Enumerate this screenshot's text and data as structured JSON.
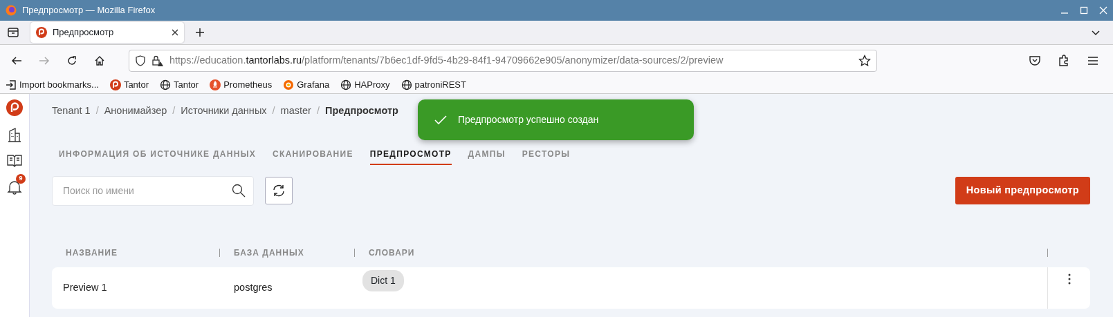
{
  "window": {
    "title": "Предпросмотр — Mozilla Firefox"
  },
  "browser_tabs": [
    {
      "label": "Предпросмотр",
      "selected": true
    }
  ],
  "address_bar": {
    "url_parts": [
      {
        "text": "https://education.",
        "emphasis": false
      },
      {
        "text": "tantorlabs.ru",
        "emphasis": true
      },
      {
        "text": "/platform/tenants/7b6ec1df-9fd5-4b29-84f1-94709662e905/anonymizer/data-sources/2/preview",
        "emphasis": false
      }
    ]
  },
  "bookmarks": [
    {
      "label": "Import bookmarks...",
      "kind": "import"
    },
    {
      "label": "Tantor",
      "kind": "tantor"
    },
    {
      "label": "Tantor",
      "kind": "globe"
    },
    {
      "label": "Prometheus",
      "kind": "prometheus"
    },
    {
      "label": "Grafana",
      "kind": "grafana"
    },
    {
      "label": "HAProxy",
      "kind": "globe"
    },
    {
      "label": "patroniREST",
      "kind": "globe"
    }
  ],
  "sidebar": {
    "notification_count": "9"
  },
  "breadcrumbs": [
    {
      "label": "Tenant 1",
      "current": false
    },
    {
      "separator": "/",
      "label": "Анонимайзер",
      "current": false
    },
    {
      "separator": "/",
      "label": "Источники данных",
      "current": false
    },
    {
      "separator": "/",
      "label": "master",
      "current": false
    },
    {
      "separator": "/",
      "label": "Предпросмотр",
      "current": true
    }
  ],
  "toast": {
    "message": "Предпросмотр успешно создан"
  },
  "tabs": [
    {
      "label": "ИНФОРМАЦИЯ ОБ ИСТОЧНИКЕ ДАННЫХ",
      "selected": false
    },
    {
      "label": "СКАНИРОВАНИЕ",
      "selected": false
    },
    {
      "label": "ПРЕДПРОСМОТР",
      "selected": true
    },
    {
      "label": "ДАМПЫ",
      "selected": false
    },
    {
      "label": "РЕСТОРЫ",
      "selected": false
    }
  ],
  "search": {
    "placeholder": "Поиск по имени"
  },
  "new_button": {
    "label": "Новый предпросмотр"
  },
  "table": {
    "columns": [
      "НАЗВАНИЕ",
      "БАЗА ДАННЫХ",
      "СЛОВАРИ"
    ],
    "rows": [
      {
        "name": "Preview 1",
        "database": "postgres",
        "dictionaries": [
          "Dict 1"
        ]
      }
    ]
  }
}
